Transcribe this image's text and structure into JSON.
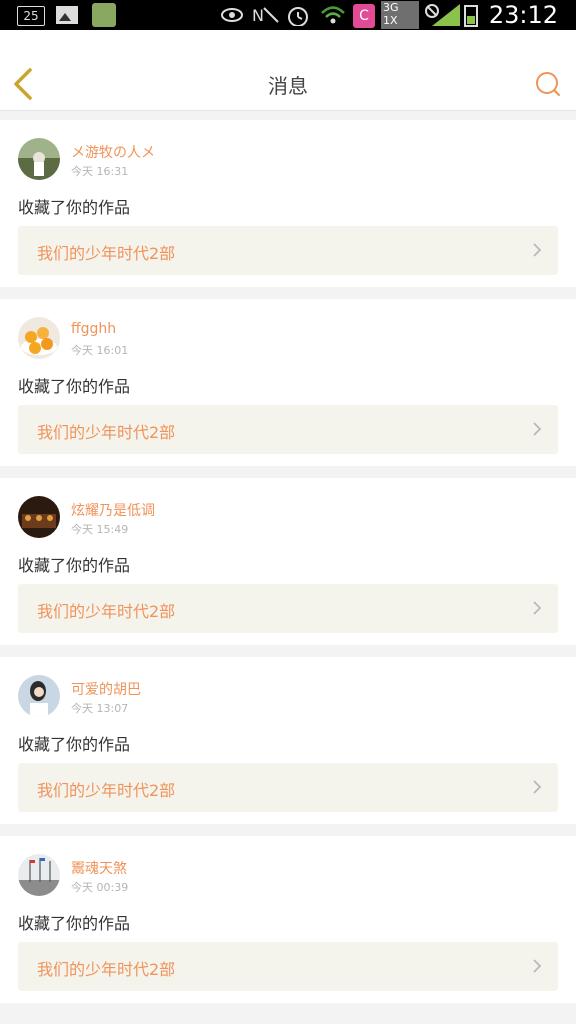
{
  "status_bar": {
    "notification_count": "25",
    "network_label_top": "3G",
    "network_label_bottom": "1X",
    "app_letter": "C",
    "time": "23:12"
  },
  "header": {
    "title": "消息",
    "back_icon": "chevron-left-icon",
    "search_icon": "search-icon",
    "accent_color": "#f0935a"
  },
  "messages": [
    {
      "name": "メ游牧の人メ",
      "time": "今天 16:31",
      "action": "收藏了你的作品",
      "work": "我们的少年时代2部"
    },
    {
      "name": "ffgghh",
      "time": "今天 16:01",
      "action": "收藏了你的作品",
      "work": "我们的少年时代2部"
    },
    {
      "name": "炫耀乃是低调",
      "time": "今天 15:49",
      "action": "收藏了你的作品",
      "work": "我们的少年时代2部"
    },
    {
      "name": "可爱的胡巴",
      "time": "今天 13:07",
      "action": "收藏了你的作品",
      "work": "我们的少年时代2部"
    },
    {
      "name": "鬻魂天煞",
      "time": "今天 00:39",
      "action": "收藏了你的作品",
      "work": "我们的少年时代2部"
    }
  ]
}
